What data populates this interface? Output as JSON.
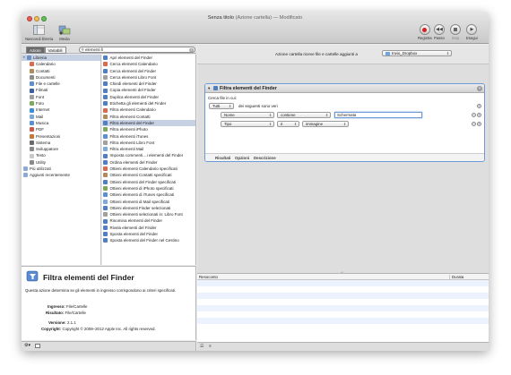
{
  "window": {
    "title": "Senza titolo",
    "subtitle": "(Azione cartella)",
    "status": "— Modificato"
  },
  "toolbar": {
    "left": [
      {
        "label": "Nascondi libreria",
        "icon": "library-icon"
      },
      {
        "label": "Media",
        "icon": "media-icon"
      }
    ],
    "right": [
      {
        "label": "Registra",
        "icon": "record-icon"
      },
      {
        "label": "Passo",
        "icon": "step-icon"
      },
      {
        "label": "Stop",
        "icon": "stop-icon"
      },
      {
        "label": "Esegui",
        "icon": "run-icon"
      }
    ]
  },
  "tabs": {
    "actions": "Azioni",
    "variables": "Variabili"
  },
  "search": {
    "value": "elementi fi"
  },
  "library": [
    {
      "label": "Libreria",
      "color": "#6d8fc5",
      "selected": true,
      "head": true
    },
    {
      "label": "Calendario",
      "color": "#d86a4f"
    },
    {
      "label": "Contatti",
      "color": "#b08a5a"
    },
    {
      "label": "Documenti",
      "color": "#8c8c8c"
    },
    {
      "label": "File e cartelle",
      "color": "#5f8ed0"
    },
    {
      "label": "Filmati",
      "color": "#3b5fa0"
    },
    {
      "label": "Font",
      "color": "#a0a0a0"
    },
    {
      "label": "Foto",
      "color": "#7ea85a"
    },
    {
      "label": "Internet",
      "color": "#3d8fd8"
    },
    {
      "label": "Mail",
      "color": "#7eaad9"
    },
    {
      "label": "Musica",
      "color": "#5b8fd4"
    },
    {
      "label": "PDF",
      "color": "#cc5a4a"
    },
    {
      "label": "Presentazioni",
      "color": "#c07a3a"
    },
    {
      "label": "Sistema",
      "color": "#6a6a6a"
    },
    {
      "label": "Sviluppatore",
      "color": "#8a8a8a"
    },
    {
      "label": "Testo",
      "color": "#c9c9c9"
    },
    {
      "label": "Utility",
      "color": "#8a8a8a"
    },
    {
      "label": "Più utilizzati",
      "color": "#8fa9d6"
    },
    {
      "label": "Aggiunti recentemente",
      "color": "#8fa9d6"
    }
  ],
  "actions": [
    {
      "label": "Apri elementi del Finder",
      "color": "#4f7fc0"
    },
    {
      "label": "Cerca elementi Calendario",
      "color": "#d86a4f"
    },
    {
      "label": "Cerca elementi del Finder",
      "color": "#4f7fc0"
    },
    {
      "label": "Cerca elementi Libro Font",
      "color": "#a0a0a0"
    },
    {
      "label": "Chiedi elementi del Finder",
      "color": "#4f7fc0"
    },
    {
      "label": "Copia elementi del Finder",
      "color": "#4f7fc0"
    },
    {
      "label": "Duplica elementi del Finder",
      "color": "#4f7fc0"
    },
    {
      "label": "Etichetta gli elementi del Finder",
      "color": "#4f7fc0"
    },
    {
      "label": "Filtra elementi Calendario",
      "color": "#d86a4f"
    },
    {
      "label": "Filtra elementi Contatti",
      "color": "#b08a5a"
    },
    {
      "label": "Filtra elementi del Finder",
      "color": "#4f7fc0",
      "selected": true
    },
    {
      "label": "Filtra elementi iPhoto",
      "color": "#7ea85a"
    },
    {
      "label": "Filtra elementi iTunes",
      "color": "#5b8fd4"
    },
    {
      "label": "Filtra elementi Libro Font",
      "color": "#a0a0a0"
    },
    {
      "label": "Filtra elementi Mail",
      "color": "#7eaad9"
    },
    {
      "label": "Imposta commenti…i elementi del Finder",
      "color": "#4f7fc0"
    },
    {
      "label": "Ordina elementi del Finder",
      "color": "#4f7fc0"
    },
    {
      "label": "Ottieni elementi Calendario specificati",
      "color": "#d86a4f"
    },
    {
      "label": "Ottieni elementi Contatti specificati",
      "color": "#b08a5a"
    },
    {
      "label": "Ottieni elementi del Finder specificati",
      "color": "#4f7fc0"
    },
    {
      "label": "Ottieni elementi di iPhoto specificati",
      "color": "#7ea85a"
    },
    {
      "label": "Ottieni elementi di iTunes specificati",
      "color": "#5b8fd4"
    },
    {
      "label": "Ottieni elementi di Mail specificati",
      "color": "#7eaad9"
    },
    {
      "label": "Ottieni elementi Finder selezionati",
      "color": "#4f7fc0"
    },
    {
      "label": "Ottieni elementi selezionati in: Libro Font",
      "color": "#a0a0a0"
    },
    {
      "label": "Rinomina elementi del Finder",
      "color": "#4f7fc0"
    },
    {
      "label": "Rivela elementi del Finder",
      "color": "#4f7fc0"
    },
    {
      "label": "Sposta elementi del Finder",
      "color": "#4f7fc0"
    },
    {
      "label": "Sposta elementi del Finder nel Cestino",
      "color": "#4f7fc0"
    }
  ],
  "description": {
    "title": "Filtra elementi del Finder",
    "text": "Questa azione determina se gli elementi in ingresso corrispondono ai criteri specificati.",
    "input_key": "Ingresso:",
    "input_val": "File/Cartelle",
    "result_key": "Risultato:",
    "result_val": "File/Cartelle",
    "version_key": "Versione:",
    "version_val": "2.1.1",
    "copyright_key": "Copyright:",
    "copyright_val": "Copyright © 2008–2012 Apple Inc.  All rights reserved."
  },
  "workflow": {
    "header_text": "Azione cartella riceve file e cartelle aggiunti a",
    "folder": "Invio_Dropbox"
  },
  "card": {
    "title": "Filtra elementi del Finder",
    "search_label": "Cerca file in cui:",
    "all_popup": "Tutti",
    "all_suffix": "dei seguenti sono veri",
    "rule1": {
      "field": "Nome",
      "op": "contiene",
      "value": "Schermata"
    },
    "rule2": {
      "field": "Tipo",
      "op": "è",
      "value": "immagine"
    },
    "footer": {
      "results": "Risultati",
      "options": "Opzioni",
      "description": "Descrizione"
    }
  },
  "log": {
    "col1": "Resoconto",
    "col2": "Durata"
  }
}
